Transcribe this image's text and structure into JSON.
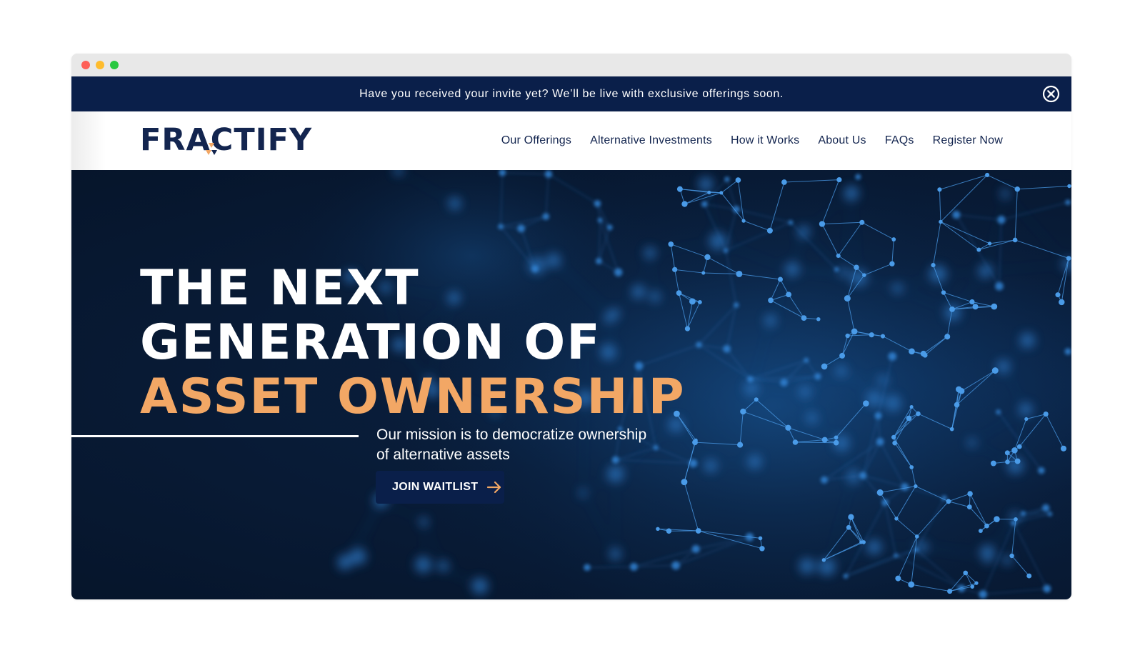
{
  "banner": {
    "text": "Have you received your invite yet? We’ll be live with exclusive offerings soon."
  },
  "logo": {
    "text": "FRACTIFY"
  },
  "nav": {
    "items": [
      {
        "label": "Our Offerings"
      },
      {
        "label": "Alternative Investments"
      },
      {
        "label": "How it Works"
      },
      {
        "label": "About Us"
      },
      {
        "label": "FAQs"
      },
      {
        "label": "Register Now"
      }
    ]
  },
  "hero": {
    "headline_line1": "THE NEXT",
    "headline_line2": "GENERATION OF",
    "headline_line3": "ASSET OWNERSHIP",
    "mission_line1": "Our mission is to democratize ownership",
    "mission_line2": "of alternative assets",
    "cta_label": "JOIN WAITLIST"
  },
  "icons": {
    "close": "close-circle-icon",
    "arrow": "arrow-right-icon",
    "network": "network-graph-background"
  },
  "colors": {
    "navy": "#0a1f4a",
    "accent_orange": "#f2a765",
    "hero_dark": "#06152b",
    "node_blue": "#3d8fe0",
    "nav_text": "#13254f"
  }
}
